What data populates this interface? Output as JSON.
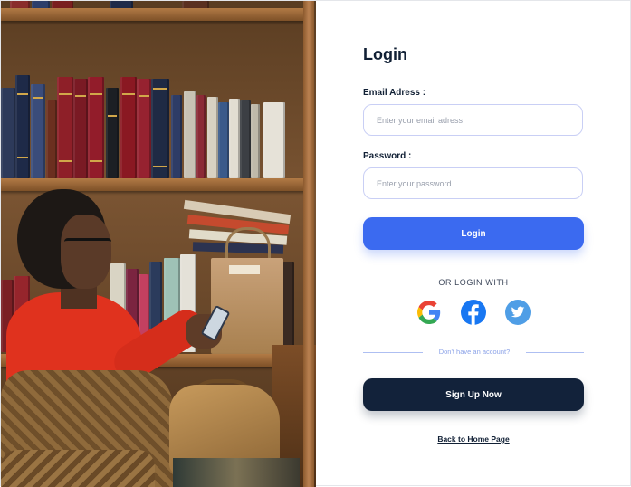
{
  "login": {
    "title": "Login",
    "email_label": "Email Adress :",
    "email_placeholder": "Enter your email adress",
    "email_value": "",
    "password_label": "Password :",
    "password_placeholder": "Enter your password",
    "password_value": "",
    "login_button": "Login",
    "or_login_with": "OR LOGIN WITH",
    "social_icons": [
      "google-icon",
      "facebook-icon",
      "twitter-icon"
    ],
    "no_account_text": "Don't have an account?",
    "signup_button": "Sign Up Now",
    "back_link": "Back to Home Page"
  },
  "colors": {
    "primary": "#3b6af0",
    "dark": "#12223a",
    "input_border": "#c9cff5",
    "facebook": "#1877f2",
    "twitter": "#4f9ee6"
  }
}
